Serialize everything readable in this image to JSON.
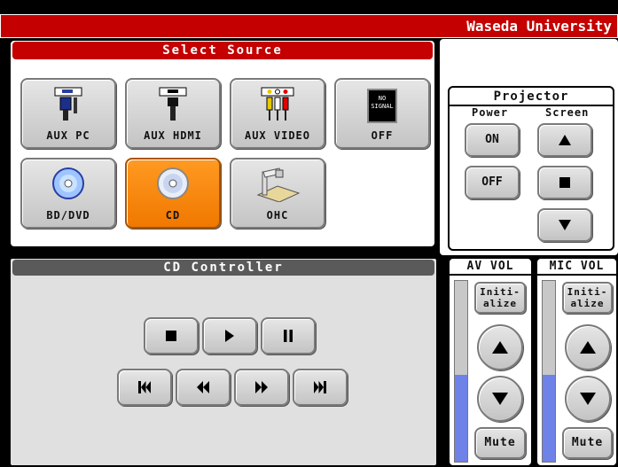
{
  "header": {
    "brand": "Waseda University"
  },
  "select_source": {
    "title": "Select Source",
    "sources": [
      {
        "label": "AUX PC",
        "icon": "vga-connector-icon"
      },
      {
        "label": "AUX HDMI",
        "icon": "hdmi-connector-icon"
      },
      {
        "label": "AUX VIDEO",
        "icon": "rca-connector-icon"
      },
      {
        "label": "OFF",
        "icon": "no-signal-icon",
        "icon_text": "NO SIGNAL"
      },
      {
        "label": "BD/DVD",
        "icon": "disc-icon"
      },
      {
        "label": "CD",
        "icon": "disc-icon",
        "selected": true
      },
      {
        "label": "OHC",
        "icon": "document-camera-icon"
      }
    ],
    "selected_color": "#f07800"
  },
  "projector": {
    "title": "Projector",
    "power_label": "Power",
    "screen_label": "Screen",
    "on_label": "ON",
    "off_label": "OFF",
    "screen_buttons": [
      "screen-up-icon",
      "screen-stop-icon",
      "screen-down-icon"
    ]
  },
  "cd_controller": {
    "title": "CD Controller",
    "row1": [
      "stop-icon",
      "play-icon",
      "pause-icon"
    ],
    "row2": [
      "skip-back-icon",
      "rewind-icon",
      "fast-forward-icon",
      "skip-forward-icon"
    ]
  },
  "av_vol": {
    "title": "AV VOL",
    "init_label_1": "Initi-",
    "init_label_2": "alize",
    "mute_label": "Mute",
    "level": 0.48
  },
  "mic_vol": {
    "title": "MIC VOL",
    "init_label_1": "Initi-",
    "init_label_2": "alize",
    "mute_label": "Mute",
    "level": 0.48
  },
  "colors": {
    "brand_red": "#c40000",
    "volume_fill": "#6e82e8",
    "title_grey": "#5a5a5a"
  }
}
